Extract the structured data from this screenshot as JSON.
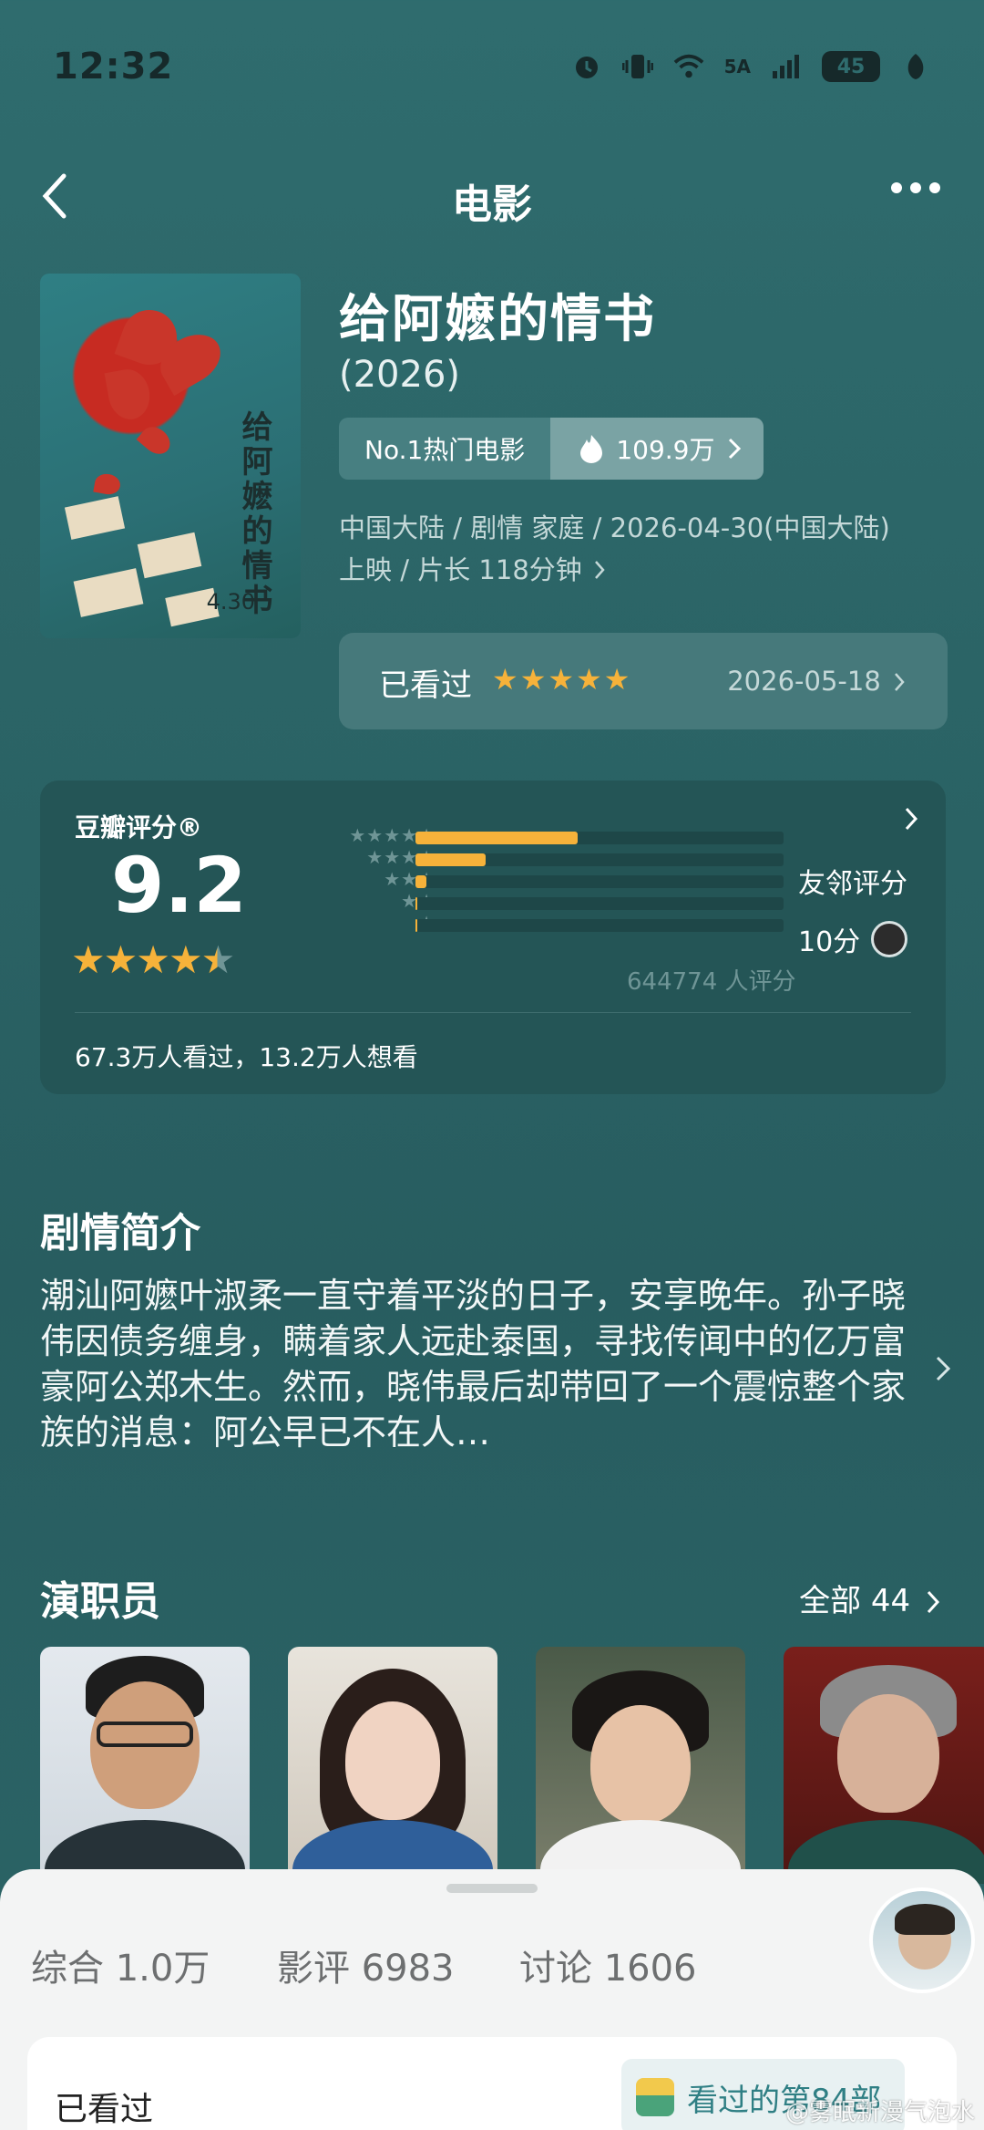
{
  "status_bar": {
    "time": "12:32",
    "network_label": "5A",
    "battery": "45"
  },
  "nav": {
    "title": "电影"
  },
  "movie": {
    "title": "给阿嬷的情书",
    "year": "(2026)",
    "rank_label": "No.1热门电影",
    "heat_value": "109.9万",
    "meta_line1": "中国大陆 / 剧情 家庭 / 2026-04-30(中国大陆)",
    "meta_line2": "上映 / 片长 118分钟",
    "poster_title": "给阿嬷的情书",
    "poster_date": "4.30"
  },
  "my_rating": {
    "label": "已看过",
    "stars": 5,
    "date": "2026-05-18"
  },
  "douban_rating": {
    "label": "豆瓣评分®",
    "score": "9.2",
    "stars": 4.5,
    "distribution_fraction": [
      0.44,
      0.19,
      0.03,
      0.005,
      0.003
    ],
    "friend_label": "友邻评分",
    "friend_score": "10分",
    "rating_count": "644774 人评分",
    "watch_summary": "67.3万人看过，13.2万人想看"
  },
  "synopsis": {
    "heading": "剧情简介",
    "text": "潮汕阿嬷叶淑柔一直守着平淡的日子，安享晚年。孙子晓伟因债务缠身，瞒着家人远赴泰国，寻找传闻中的亿万富豪阿公郑木生。然而，晓伟最后却带回了一个震惊整个家族的消息：阿公早已不在人…"
  },
  "cast": {
    "heading": "演职员",
    "all_label": "全部 44"
  },
  "bottom_sheet": {
    "tabs": [
      {
        "label": "综合 1.0万"
      },
      {
        "label": "影评 6983"
      },
      {
        "label": "讨论 1606"
      }
    ],
    "seen_label": "已看过",
    "badge_text": "看过的第84部"
  },
  "watermark": "@雾眠新漫气泡水",
  "colors": {
    "star": "#f6b23a",
    "background": "#2f6c6e",
    "sheet": "#f3f4f4"
  }
}
